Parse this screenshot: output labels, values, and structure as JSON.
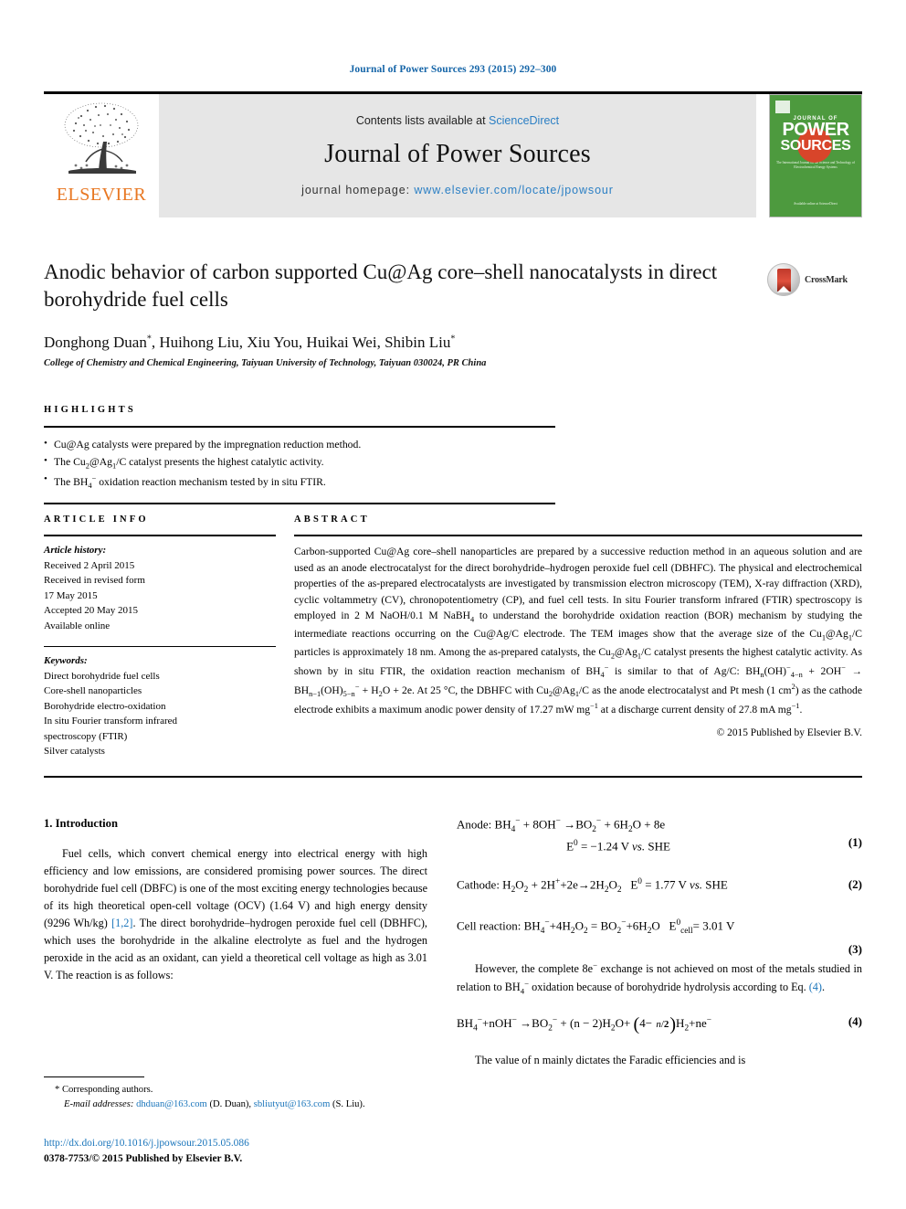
{
  "running_head": "Journal of Power Sources 293 (2015) 292–300",
  "masthead": {
    "publisher": "ELSEVIER",
    "contents_prefix": "Contents lists available at ",
    "contents_link": "ScienceDirect",
    "journal_name": "Journal of Power Sources",
    "homepage_prefix": "journal homepage: ",
    "homepage_url": "www.elsevier.com/locate/jpowsour",
    "cover": {
      "top_label": "JOURNAL OF",
      "word1": "POWER",
      "word2": "SOURCES",
      "blurb": "The International Journal on the Science and Technology of Electrochemical Energy Systems",
      "foot": "Available online at\nScienceDirect"
    }
  },
  "article": {
    "title": "Anodic behavior of carbon supported Cu@Ag core–shell nanocatalysts in direct borohydride fuel cells",
    "authors_html": "Donghong Duan<sup>*</sup>, Huihong Liu, Xiu You, Huikai Wei, Shibin Liu<sup>*</sup>",
    "affiliation": "College of Chemistry and Chemical Engineering, Taiyuan University of Technology, Taiyuan 030024, PR China",
    "crossmark_label": "CrossMark"
  },
  "highlights": {
    "label": "HIGHLIGHTS",
    "items": [
      "Cu@Ag catalysts were prepared by the impregnation reduction method.",
      "The Cu<sub>2</sub>@Ag<sub>1</sub>/C catalyst presents the highest catalytic activity.",
      "The BH<sub>4</sub><sup>−</sup> oxidation reaction mechanism tested by in situ FTIR."
    ]
  },
  "article_info": {
    "label": "ARTICLE INFO",
    "history_head": "Article history:",
    "history": [
      "Received 2 April 2015",
      "Received in revised form",
      "17 May 2015",
      "Accepted 20 May 2015",
      "Available online"
    ],
    "keywords_head": "Keywords:",
    "keywords": [
      "Direct borohydride fuel cells",
      "Core-shell nanoparticles",
      "Borohydride electro-oxidation",
      "In situ Fourier transform infrared",
      "spectroscopy (FTIR)",
      "Silver catalysts"
    ]
  },
  "abstract": {
    "label": "ABSTRACT",
    "text_html": "Carbon-supported Cu@Ag core–shell nanoparticles are prepared by a successive reduction method in an aqueous solution and are used as an anode electrocatalyst for the direct borohydride–hydrogen peroxide fuel cell (DBHFC). The physical and electrochemical properties of the as-prepared electrocatalysts are investigated by transmission electron microscopy (TEM), X-ray diffraction (XRD), cyclic voltammetry (CV), chronopotentiometry (CP), and fuel cell tests. In situ Fourier transform infrared (FTIR) spectroscopy is employed in 2 M NaOH/0.1 M NaBH<sub>4</sub> to understand the borohydride oxidation reaction (BOR) mechanism by studying the intermediate reactions occurring on the Cu@Ag/C electrode. The TEM images show that the average size of the Cu<sub>1</sub>@Ag<sub>1</sub>/C particles is approximately 18 nm. Among the as-prepared catalysts, the Cu<sub>2</sub>@Ag<sub>1</sub>/C catalyst presents the highest catalytic activity. As shown by in situ FTIR, the oxidation reaction mechanism of BH<sub>4</sub><sup>−</sup> is similar to that of Ag/C: BH<sub>n</sub>(OH)<span style=\"display:inline-block\"><sup>−</sup></span><sub>4−n</sub> + 2OH<sup>−</sup> → BH<sub>n−1</sub>(OH)<sub>5−n</sub><sup>−</sup> + H<sub>2</sub>O + 2e. At 25 °C, the DBHFC with Cu<sub>2</sub>@Ag<sub>1</sub>/C as the anode electrocatalyst and Pt mesh (1 cm<sup>2</sup>) as the cathode electrode exhibits a maximum anodic power density of 17.27 mW mg<sup>−1</sup> at a discharge current density of 27.8 mA mg<sup>−1</sup>.",
    "copyright": "© 2015 Published by Elsevier B.V."
  },
  "introduction": {
    "heading": "1. Introduction",
    "paragraph_html": "Fuel cells, which convert chemical energy into electrical energy with high efficiency and low emissions, are considered promising power sources. The direct borohydride fuel cell (DBFC) is one of the most exciting energy technologies because of its high theoretical open-cell voltage (OCV) (1.64 V) and high energy density (9296 Wh/kg) <span class=\"lnk\">[1,2]</span>. The direct borohydride–hydrogen peroxide fuel cell (DBHFC), which uses the borohydride in the alkaline electrolyte as fuel and the hydrogen peroxide in the acid as an oxidant, can yield a theoretical cell voltage as high as 3.01 V. The reaction is as follows:"
  },
  "equations": [
    {
      "id": "eq1",
      "main_html": "Anode: BH<sub>4</sub><sup>−</sup> + 8OH<sup>−</sup> →BO<sub>2</sub><sup>−</sup> + 6H<sub>2</sub>O + 8e",
      "sub_html": "E<sup>0</sup> = −1.24 V <i>vs.</i> SHE",
      "number": "(1)"
    },
    {
      "id": "eq2",
      "main_html": "Cathode: H<sub>2</sub>O<sub>2</sub> + 2H<sup>+</sup>+2e→2H<sub>2</sub>O<sub>2</sub>&nbsp;&nbsp;&nbsp;E<sup>0</sup> = 1.77 V <i>vs.</i> SHE",
      "sub_html": "",
      "number": "(2)"
    },
    {
      "id": "eq3",
      "main_html": "Cell reaction: BH<sub>4</sub><sup>−</sup>+4H<sub>2</sub>O<sub>2</sub> = BO<sub>2</sub><sup>−</sup>+6H<sub>2</sub>O&nbsp;&nbsp;&nbsp;E<sup>0</sup><sub>cell</sub>= 3.01 V",
      "sub_html": "",
      "number": "(3)"
    }
  ],
  "post_eq_paragraph_html": "However, the complete 8e<sup>−</sup> exchange is not achieved on most of the metals studied in relation to BH<sub>4</sub><sup>−</sup> oxidation because of borohydride hydrolysis according to Eq. <span class=\"lnk\">(4)</span>.",
  "equation4": {
    "main_html": "BH<sub>4</sub><sup>−</sup>+nOH<sup>−</sup> →BO<sub>2</sub><sup>−</sup> + (n − 2)H<sub>2</sub>O+ <span class=\"paren-big\">(</span>4− <span class=\"frac\"><i>n</i>/<b>2</b></span><span class=\"paren-big\">)</span>H<sub>2</sub>+ne<sup>−</sup>",
    "number": "(4)"
  },
  "final_paragraph_html": "The value of n mainly dictates the Faradic efficiencies and is",
  "footnote": {
    "corresponding": "* Corresponding authors.",
    "email_label": "E-mail addresses:",
    "email1": "dhduan@163.com",
    "email1_attr": "(D. Duan),",
    "email2": "sbliutyut@163.com",
    "email2_attr": "(S. Liu)."
  },
  "doi": {
    "url": "http://dx.doi.org/10.1016/j.jpowsour.2015.05.086",
    "issn_line": "0378-7753/© 2015 Published by Elsevier B.V."
  },
  "colors": {
    "link_blue": "#1a75bb",
    "header_blue": "#1565a8",
    "elsevier_orange": "#E87722",
    "cover_green": "#4d9a3e",
    "masthead_gray": "#e6e6e6"
  }
}
